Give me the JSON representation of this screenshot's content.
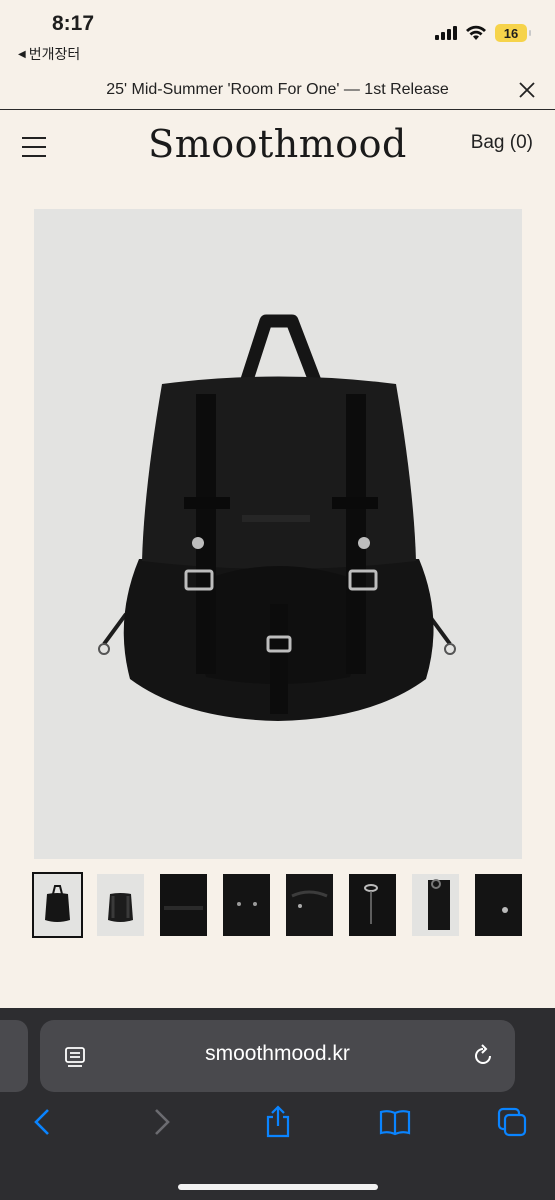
{
  "status": {
    "time": "8:17",
    "back_label": "번개장터",
    "battery": "16"
  },
  "announcement": {
    "text": "25' Mid-Summer 'Room For One' — 1st Release"
  },
  "header": {
    "logo": "Smoothmood",
    "bag_label": "Bag (0)"
  },
  "product": {
    "main_image": "black-backpack-photo",
    "thumbnails": [
      {
        "name": "thumbnail-front"
      },
      {
        "name": "thumbnail-back"
      },
      {
        "name": "thumbnail-strap"
      },
      {
        "name": "thumbnail-flap"
      },
      {
        "name": "thumbnail-top"
      },
      {
        "name": "thumbnail-drawcord"
      },
      {
        "name": "thumbnail-side"
      },
      {
        "name": "thumbnail-buckle"
      }
    ],
    "selected_thumbnail": 0
  },
  "browser": {
    "url": "smoothmood.kr"
  },
  "colors": {
    "background": "#f7f1e9",
    "image_bg": "#e3e3e1",
    "browser_bar": "#2d2d30",
    "accent": "#0a84ff",
    "battery": "#f6d34a"
  }
}
